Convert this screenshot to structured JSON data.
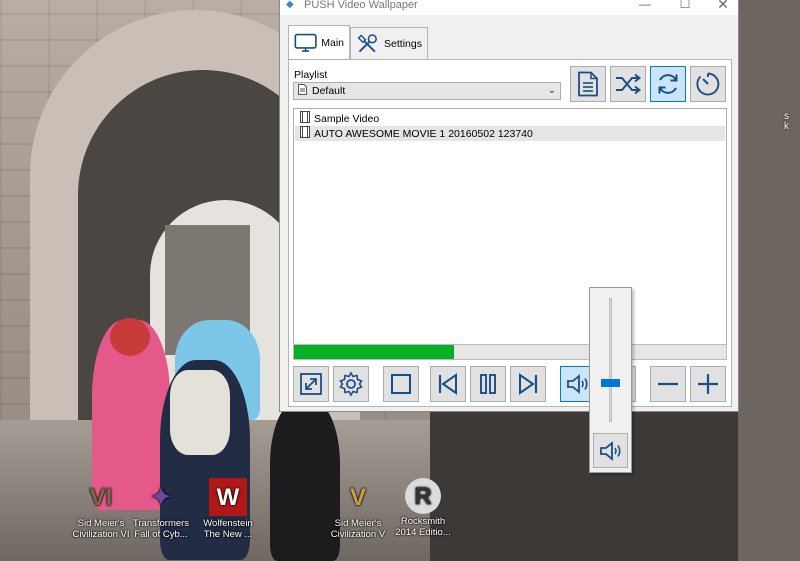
{
  "window": {
    "title": "PUSH Video Wallpaper",
    "minimize_glyph": "—",
    "maximize_glyph": "☐",
    "close_glyph": "✕"
  },
  "tabs": [
    {
      "label": "Main",
      "icon": "monitor-icon",
      "active": true
    },
    {
      "label": "Settings",
      "icon": "tools-icon",
      "active": false
    }
  ],
  "playlist": {
    "label": "Playlist",
    "selected": "Default"
  },
  "videos": [
    {
      "name": "Sample Video",
      "selected": false
    },
    {
      "name": "AUTO AWESOME MOVIE 1 20160502 123740",
      "selected": true
    }
  ],
  "playback_progress": 0.37,
  "volume_level": 0.3,
  "colors": {
    "accent": "#0078d7",
    "progress": "#06b025",
    "selected_button": "#cce4f7"
  },
  "desktop_icons": [
    {
      "name": "Sid Meier's Civilization VI",
      "line1": "Sid Meier's",
      "line2": "Civilization VI",
      "glyph": "VI",
      "color": "#7a6a4a"
    },
    {
      "name": "Transformers Fall of Cybertron",
      "line1": "Transformers",
      "line2": "Fall of Cyb...",
      "glyph": "✦",
      "color": "#6a4aa8"
    },
    {
      "name": "Wolfenstein The New Order",
      "line1": "Wolfenstein",
      "line2": "The New ...",
      "glyph": "W",
      "color": "#b01818"
    },
    {
      "name": "Sid Meier's Civilization V",
      "line1": "Sid Meier's",
      "line2": "Civilization V",
      "glyph": "V",
      "color": "#c9a040"
    },
    {
      "name": "Rocksmith 2014 Edition",
      "line1": "Rocksmith",
      "line2": "2014 Editio...",
      "glyph": "R",
      "color": "#303438"
    }
  ],
  "edge_text": "s\nk"
}
